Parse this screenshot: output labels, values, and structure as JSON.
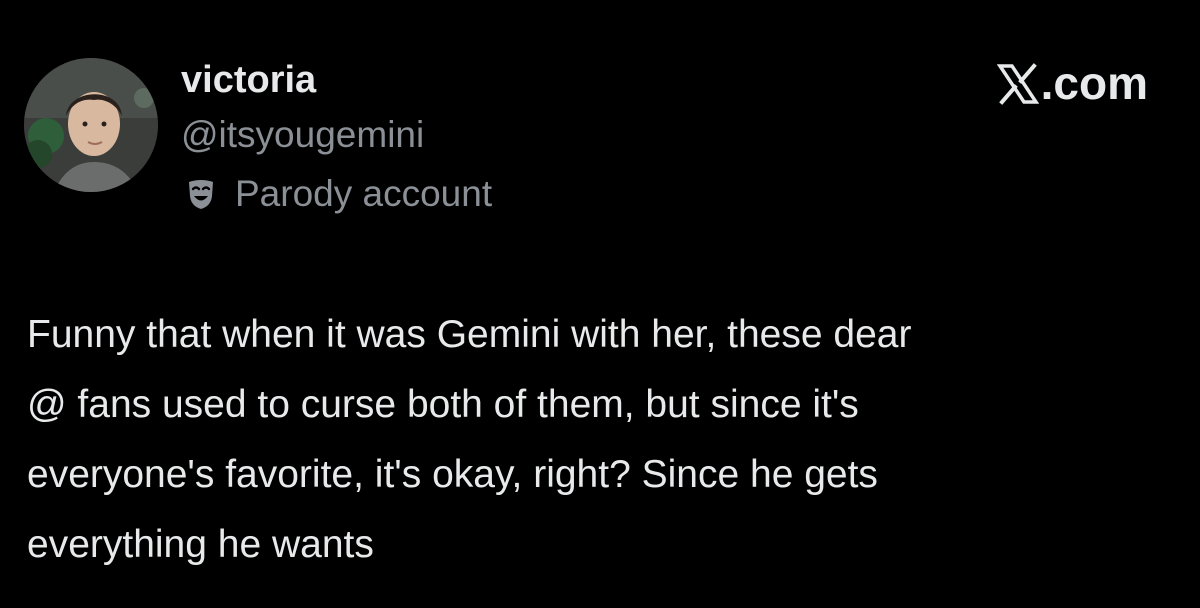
{
  "post": {
    "author": {
      "display_name": "victoria",
      "handle": "@itsyougemini",
      "account_label": "Parody account",
      "avatar_icon": "profile-photo",
      "account_label_icon": "theater-mask-icon"
    },
    "brand": {
      "label": ".com",
      "logo_icon": "x-logo-icon"
    },
    "text": "Funny that when it was Gemini with her, these dear\n@ fans used to curse both of them, but since it's\neveryone's favorite, it's okay, right? Since he gets\neverything he wants"
  },
  "colors": {
    "background": "#000000",
    "primary_text": "#e7e9ea",
    "secondary_text": "#8b9096"
  }
}
